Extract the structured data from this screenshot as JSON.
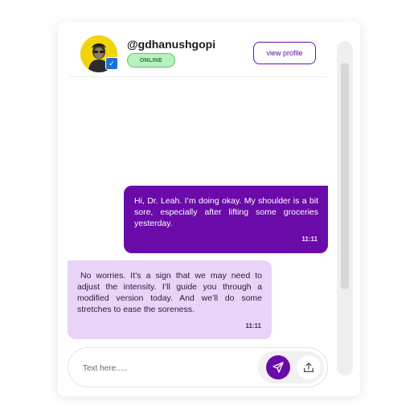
{
  "profile": {
    "username": "@gdhanushgopi",
    "status": "ONLINE",
    "view_profile_label": "view profile",
    "avatar_icon": "user-photo",
    "verified_icon": "verified-badge-icon"
  },
  "messages": [
    {
      "direction": "outgoing",
      "text": "Hi, Dr. Leah. I’m doing okay. My shoulder is a bit sore, especially after lifting some groceries yesterday.",
      "time": "11:11"
    },
    {
      "direction": "incoming",
      "text": "No worries. It’s a sign that we may need to adjust the intensity. I’ll guide you through a modified version today. And we’ll do some stretches to ease the soreness.",
      "time": "11:11"
    }
  ],
  "composer": {
    "placeholder": "Text here.....",
    "send_icon": "send-icon",
    "upload_icon": "upload-icon"
  },
  "colors": {
    "accent": "#6a0aa8",
    "incoming_bubble": "#e9d3f7",
    "online_badge": "#b9f0c0"
  }
}
